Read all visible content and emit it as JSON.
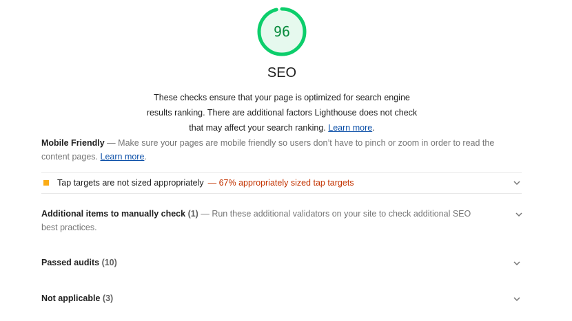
{
  "gauge": {
    "score": "96",
    "fraction": 0.96,
    "color": "#0cce6b"
  },
  "category": {
    "title": "SEO",
    "description_line1": "These checks ensure that your page is optimized for search engine",
    "description_line2": "results ranking. There are additional factors Lighthouse does not check",
    "description_line3": "that may affect your search ranking.",
    "learn_more": "Learn more",
    "period": "."
  },
  "mobile_friendly": {
    "title": "Mobile Friendly",
    "dash": "—",
    "description": "Make sure your pages are mobile friendly so users don’t have to pinch or zoom in order to read the content pages.",
    "learn_more": "Learn more",
    "period": "."
  },
  "audit": {
    "title": "Tap targets are not sized appropriately",
    "display_value": "— 67% appropriately sized tap targets"
  },
  "manual_checks": {
    "title": "Additional items to manually check",
    "count": "(1)",
    "dash": "—",
    "description": "Run these additional validators on your site to check additional SEO best practices."
  },
  "passed_audits": {
    "title": "Passed audits",
    "count": "(10)"
  },
  "not_applicable": {
    "title": "Not applicable",
    "count": "(3)"
  },
  "colors": {
    "pass": "#0cce6b",
    "average": "#ffa400",
    "fail_text": "#c33300",
    "link": "#0b4fa8"
  }
}
